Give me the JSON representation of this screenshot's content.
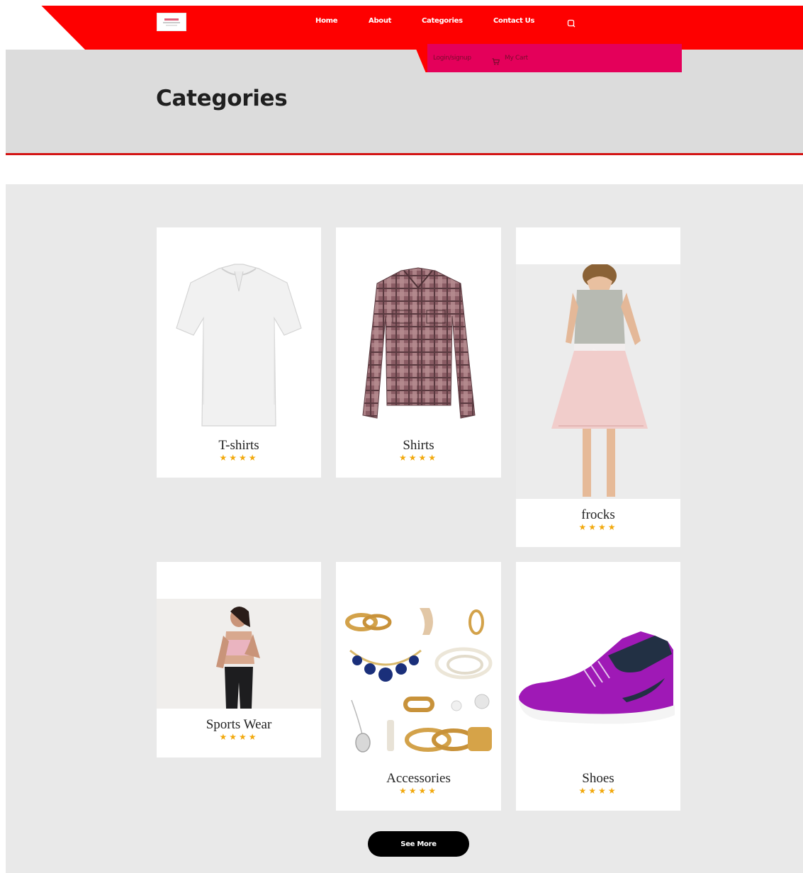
{
  "header": {
    "nav": [
      {
        "label": "Home"
      },
      {
        "label": "About"
      },
      {
        "label": "Categories"
      },
      {
        "label": "Contact Us"
      }
    ],
    "account_label": "Login/signup",
    "cart_label": "My Cart"
  },
  "page": {
    "title": "Categories"
  },
  "products": [
    {
      "name": "T-shirts",
      "rating": 4
    },
    {
      "name": "Shirts",
      "rating": 4
    },
    {
      "name": "frocks",
      "rating": 4
    },
    {
      "name": "Sports Wear",
      "rating": 4
    },
    {
      "name": "Accessories",
      "rating": 4
    },
    {
      "name": "Shoes",
      "rating": 4
    }
  ],
  "see_more_label": "See More",
  "colors": {
    "header_red": "#fe0000",
    "subbar_pink": "#e4005a",
    "star": "#f2a90e",
    "button": "#000000"
  },
  "icons": {
    "search": "search-icon",
    "cart": "cart-icon",
    "star": "star-icon"
  }
}
